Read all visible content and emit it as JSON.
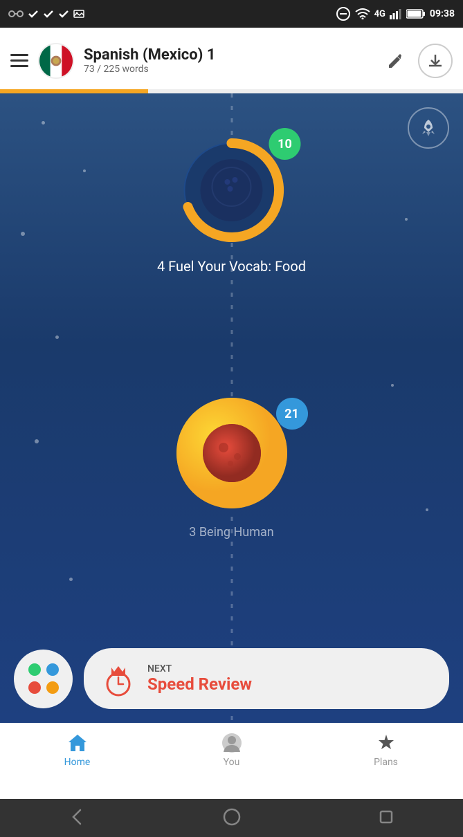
{
  "statusBar": {
    "time": "09:38",
    "network": "4G"
  },
  "appBar": {
    "menuLabel": "menu",
    "title": "Spanish (Mexico) 1",
    "wordsProgress": "73 / 225 words",
    "progressPercent": 32,
    "editLabel": "edit",
    "downloadLabel": "download"
  },
  "lesson1": {
    "badge": "10",
    "title": "4 Fuel Your Vocab: Food"
  },
  "lesson2": {
    "badge": "21",
    "title": "3 Being Human"
  },
  "nextCard": {
    "label": "NEXT",
    "title": "Speed Review"
  },
  "bottomNav": {
    "items": [
      {
        "id": "home",
        "label": "Home",
        "active": true
      },
      {
        "id": "you",
        "label": "You",
        "active": false
      },
      {
        "id": "plans",
        "label": "Plans",
        "active": false
      }
    ]
  },
  "dots": [
    {
      "color": "#2ecc71"
    },
    {
      "color": "#3498db"
    },
    {
      "color": "#e74c3c"
    },
    {
      "color": "#f39c12"
    }
  ]
}
